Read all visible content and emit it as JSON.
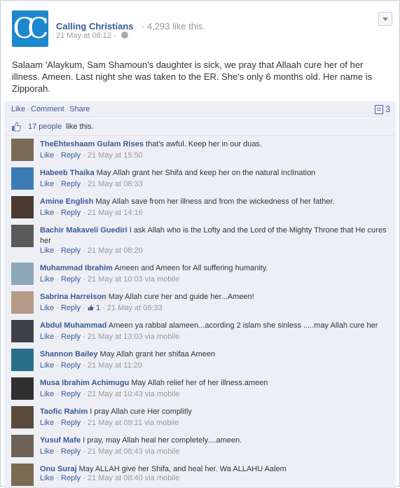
{
  "post": {
    "page_name": "Calling Christians",
    "page_likes": "· 4,293 like this.",
    "date": "21 May at 08:12 ·",
    "avatar_text": "CC",
    "text": "Salaam 'Alaykum, Sam Shamoun's daughter is sick, we pray that Allaah cure her of her illness. Ameen. Last night she was taken to the ER. She's only 6 months old. Her name is Zipporah."
  },
  "actions": {
    "like": "Like",
    "comment": "Comment",
    "share": "Share",
    "sep": "·",
    "share_count": "3"
  },
  "likes": {
    "people": "17 people",
    "suffix": "like this."
  },
  "comments": [
    {
      "author": "TheEhteshaam Gulam Rises",
      "text": " that's awful. Keep her in our duas.",
      "meta": "21 May at 15:50",
      "avatar": "#7a6a58"
    },
    {
      "author": "Habeeb Thaika",
      "text": " May Allah grant her Shifa and keep her on the natural inclination",
      "meta": "21 May at 08:33",
      "avatar": "#3d7bb5"
    },
    {
      "author": "Amine English",
      "text": " May Allah save from her illness and from the wickedness of her father.",
      "meta": "21 May at 14:16",
      "avatar": "#4a3a30"
    },
    {
      "author": "Bachir Makaveli Guediri",
      "text": " I ask Allah who is the Lofty and the Lord of the Mighty Throne that He cures her",
      "meta": "21 May at 08:20",
      "avatar": "#5a5a5a"
    },
    {
      "author": "Muhammad Ibrahim",
      "text": " Ameen and Ameen for All suffering humanity.",
      "meta": "21 May at 10:03 via mobile",
      "avatar": "#8ea8b8"
    },
    {
      "author": "Sabrina Harrelson",
      "text": " May Allah cure her and guide her...Ameen!",
      "meta": "21 May at 08:33",
      "avatar": "#b59a86",
      "like_count": "1"
    },
    {
      "author": "Abdul Muhammad",
      "text": " Ameen ya rabbal alameen...acording 2 islam she sinless .....may Allah cure her",
      "meta": "21 May at 13:03 via mobile",
      "avatar": "#40404a"
    },
    {
      "author": "Shannon Bailey",
      "text": " May Allah grant her shifaa Ameen",
      "meta": "21 May at 11:20",
      "avatar": "#2a6f8a"
    },
    {
      "author": "Musa Ibrahim Achimugu",
      "text": " May Allah relief her of her illness.ameen",
      "meta": "21 May at 10:43 via mobile",
      "avatar": "#303030"
    },
    {
      "author": "Taofic Rahim",
      "text": " I pray Allah cure Her complitly",
      "meta": "21 May at 09:11 via mobile",
      "avatar": "#5a4a3e"
    },
    {
      "author": "Yusuf Mafe",
      "text": " I pray, may Allah heal her completely....ameen.",
      "meta": "21 May at 08:43 via mobile",
      "avatar": "#6e6258"
    },
    {
      "author": "Onu Suraj",
      "text": " May ALLAH give her Shifa, and heal her. Wa ALLAHU Aalem",
      "meta": "21 May at 08:40 via mobile",
      "avatar": "#7a6a50"
    }
  ],
  "comment_like": "Like",
  "comment_reply": "Reply",
  "colors": {
    "link": "#3b5998",
    "panel": "#edeff4",
    "muted": "#999999"
  }
}
